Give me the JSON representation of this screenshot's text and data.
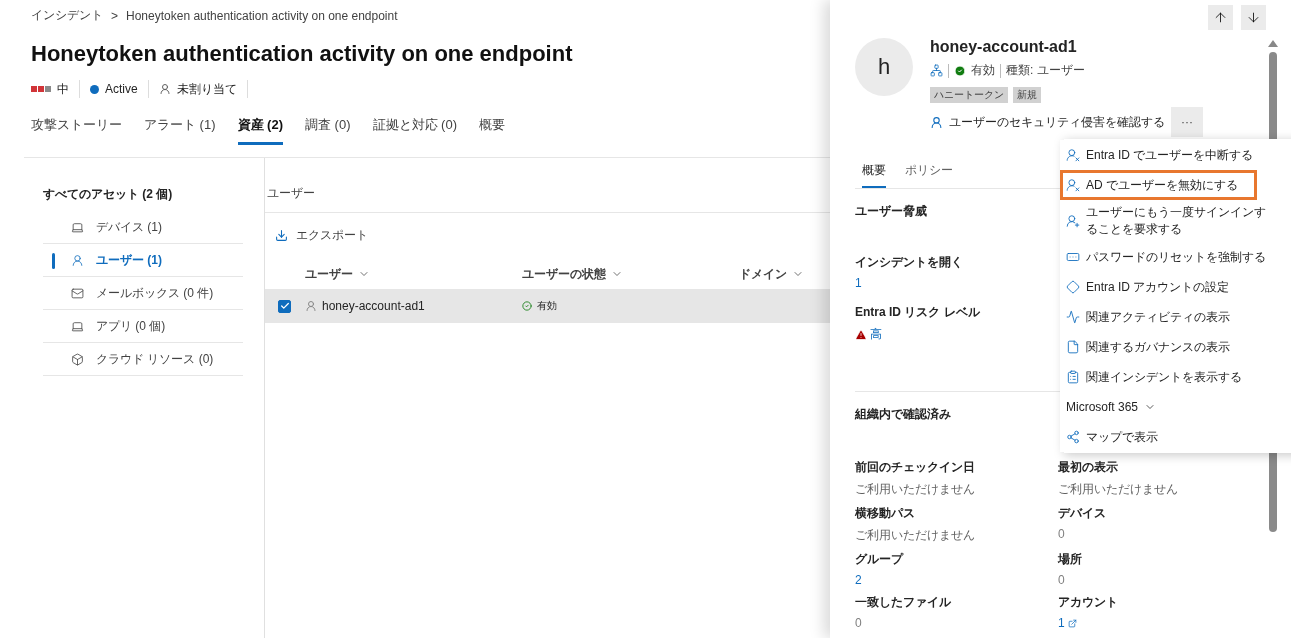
{
  "breadcrumb": {
    "parent": "インシデント",
    "separator": ">",
    "current": "Honeytoken authentication activity on one endpoint"
  },
  "title": "Honeytoken authentication activity on one endpoint",
  "meta": {
    "severity": {
      "stars": 2,
      "label": "中"
    },
    "status": {
      "label": "Active",
      "color": "#0f6cbd"
    },
    "assignee": "未割り当て"
  },
  "tabs": [
    {
      "label": "攻撃ストーリー",
      "selected": false
    },
    {
      "label": "アラート (1)",
      "selected": false
    },
    {
      "label": "資産 (2)",
      "selected": true
    },
    {
      "label": "調査 (0)",
      "selected": false
    },
    {
      "label": "証拠と対応 (0)",
      "selected": false
    },
    {
      "label": "概要",
      "selected": false
    }
  ],
  "sidebar": {
    "heading": "すべてのアセット (2 個)",
    "items": [
      {
        "kind": "device",
        "label": "デバイス (1)",
        "selected": false
      },
      {
        "kind": "user",
        "label": "ユーザー (1)",
        "selected": true
      },
      {
        "kind": "mail",
        "label": "メールボックス (0 件)",
        "selected": false
      },
      {
        "kind": "app",
        "label": "アプリ (0 個)",
        "selected": false
      },
      {
        "kind": "cloud",
        "label": "クラウド リソース (0)",
        "selected": false
      }
    ]
  },
  "table": {
    "heading": "ユーザー",
    "export": "エクスポート",
    "columns": [
      "ユーザー",
      "ユーザーの状態",
      "ドメイン"
    ],
    "rows": [
      {
        "user": "honey-account-ad1",
        "state": "有効",
        "checked": true,
        "selected": true
      }
    ]
  },
  "panel": {
    "avatar": "h",
    "name": "honey-account-ad1",
    "status": "有効",
    "type": "種類: ユーザー",
    "tags": [
      "ハニートークン",
      "新規"
    ],
    "action": "ユーザーのセキュリティ侵害を確認する",
    "more": "···",
    "tabs": [
      {
        "label": "概要",
        "selected": true
      },
      {
        "label": "ポリシー",
        "selected": false
      }
    ],
    "threat": {
      "heading": "ユーザー脅威",
      "fields": [
        {
          "label": "インシデントを開く",
          "value": "1",
          "kind": "link"
        },
        {
          "label": "Entra ID リスク レベル",
          "value": "高",
          "kind": "risk"
        }
      ]
    },
    "org": {
      "heading": "組織内で確認済み",
      "fields": [
        {
          "label": "前回のチェックイン日",
          "value": "ご利用いただけません",
          "kind": "text"
        },
        {
          "label": "最初の表示",
          "value": "ご利用いただけません",
          "kind": "text"
        },
        {
          "label": "横移動パス",
          "value": "ご利用いただけません",
          "kind": "text"
        },
        {
          "label": "デバイス",
          "value": "0",
          "kind": "muted"
        },
        {
          "label": "グループ",
          "value": "2",
          "kind": "link"
        },
        {
          "label": "場所",
          "value": "0",
          "kind": "muted"
        },
        {
          "label": "一致したファイル",
          "value": "0",
          "kind": "muted"
        },
        {
          "label": "アカウント",
          "value": "1",
          "kind": "external"
        }
      ]
    }
  },
  "menu": [
    {
      "kind": "suspend",
      "label": "Entra ID でユーザーを中断する",
      "selected": false
    },
    {
      "kind": "disable",
      "label": "AD でユーザーを無効にする",
      "selected": true
    },
    {
      "kind": "signin",
      "label": "ユーザーにもう一度サインインすることを要求する",
      "selected": false
    },
    {
      "kind": "password",
      "label": "パスワードのリセットを強制する",
      "selected": false
    },
    {
      "kind": "settings",
      "label": "Entra ID アカウントの設定",
      "selected": false
    },
    {
      "kind": "activity",
      "label": "関連アクティビティの表示",
      "selected": false
    },
    {
      "kind": "governance",
      "label": "関連するガバナンスの表示",
      "selected": false
    },
    {
      "kind": "incident",
      "label": "関連インシデントを表示する",
      "selected": false
    },
    {
      "kind": "group",
      "label": "Microsoft 365",
      "selected": false
    },
    {
      "kind": "map",
      "label": "マップで表示",
      "selected": false
    }
  ]
}
